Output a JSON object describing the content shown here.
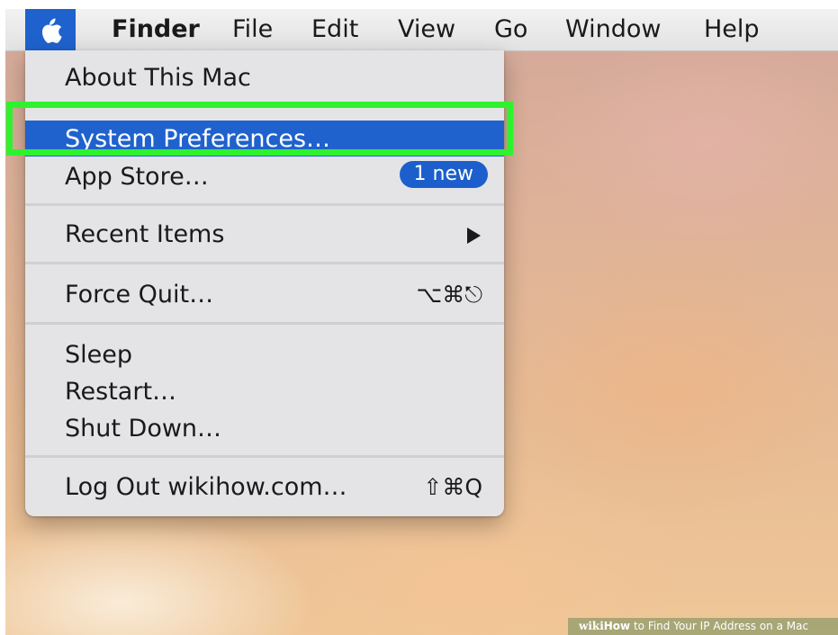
{
  "menubar": {
    "apple_icon": "apple-icon",
    "app_name": "Finder",
    "items": [
      "File",
      "Edit",
      "View",
      "Go",
      "Window",
      "Help"
    ]
  },
  "apple_menu": {
    "about": "About This Mac",
    "system_preferences": "System Preferences…",
    "app_store": "App Store…",
    "app_store_badge": "1 new",
    "recent_items": "Recent Items",
    "recent_items_arrow": "submenu-arrow-icon",
    "force_quit": "Force Quit…",
    "force_quit_shortcut": "⌥⌘⎋",
    "sleep": "Sleep",
    "restart": "Restart…",
    "shut_down": "Shut Down…",
    "log_out": "Log Out wikihow.com…",
    "log_out_shortcut": "⇧⌘Q"
  },
  "annotation": {
    "highlight_color": "#2ef22e",
    "highlighted_item": "System Preferences…"
  },
  "watermark": {
    "wiki": "wiki",
    "how": "How",
    "text": " to Find Your IP Address on a Mac"
  },
  "colors": {
    "accent_blue": "#1f62cd",
    "menu_background": "#e4e4e6"
  }
}
